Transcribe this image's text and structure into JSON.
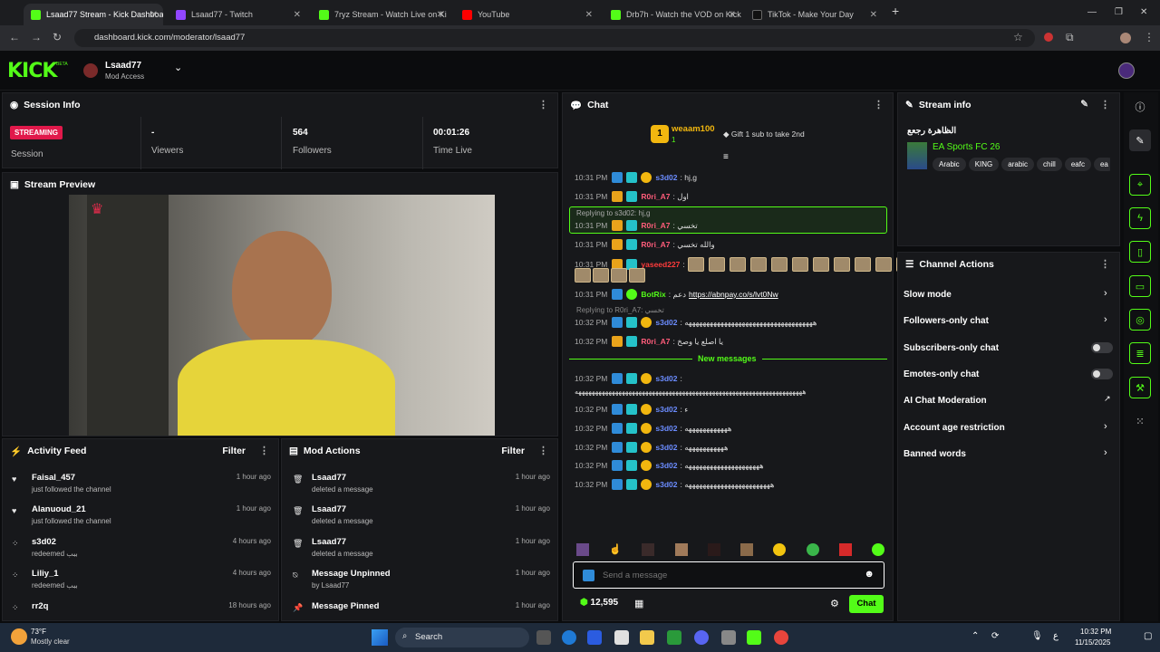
{
  "browser": {
    "tabs": [
      {
        "title": "Lsaad77 Stream - Kick Dashboa",
        "color": "#53fc18",
        "active": true
      },
      {
        "title": "Lsaad77 - Twitch",
        "color": "#9146ff"
      },
      {
        "title": "7ryz Stream - Watch Live on Ki",
        "color": "#53fc18"
      },
      {
        "title": "YouTube",
        "color": "#ff0000"
      },
      {
        "title": "Drb7h - Watch the VOD on Kick",
        "color": "#53fc18"
      },
      {
        "title": "TikTok - Make Your Day",
        "color": "#111111"
      }
    ],
    "url": "dashboard.kick.com/moderator/lsaad77"
  },
  "header": {
    "logo": "KICK",
    "beta": "BETA",
    "username": "Lsaad77",
    "role": "Mod Access"
  },
  "session": {
    "title": "Session Info",
    "status": "STREAMING",
    "status_label": "Session",
    "stats": [
      {
        "value": "-",
        "label": "Viewers"
      },
      {
        "value": "564",
        "label": "Followers"
      },
      {
        "value": "00:01:26",
        "label": "Time Live"
      }
    ],
    "preview_title": "Stream Preview"
  },
  "activity": {
    "title": "Activity Feed",
    "filter": "Filter",
    "items": [
      {
        "name": "Faisal_457",
        "sub": "just followed the channel",
        "time": "1 hour ago",
        "icon": "heart-icon"
      },
      {
        "name": "Alanuoud_21",
        "sub": "just followed the channel",
        "time": "1 hour ago",
        "icon": "heart-icon"
      },
      {
        "name": "s3d02",
        "sub": "redeemed ببب",
        "time": "4 hours ago",
        "icon": "points-icon"
      },
      {
        "name": "Liliy_1",
        "sub": "redeemed ببب",
        "time": "4 hours ago",
        "icon": "points-icon"
      },
      {
        "name": "rr2q",
        "sub": "",
        "time": "18 hours ago",
        "icon": "points-icon"
      }
    ]
  },
  "modactions": {
    "title": "Mod Actions",
    "filter": "Filter",
    "items": [
      {
        "name": "Lsaad77",
        "sub": "deleted a message",
        "time": "1 hour ago"
      },
      {
        "name": "Lsaad77",
        "sub": "deleted a message",
        "time": "1 hour ago"
      },
      {
        "name": "Lsaad77",
        "sub": "deleted a message",
        "time": "1 hour ago"
      },
      {
        "name": "Message Unpinned",
        "sub": "by Lsaad77",
        "time": "1 hour ago"
      },
      {
        "name": "Message Pinned",
        "sub": "",
        "time": "1 hour ago"
      }
    ]
  },
  "chat": {
    "title": "Chat",
    "top_gifter": {
      "name": "weaam100",
      "count": "1",
      "text": "Gift 1 sub to take 2nd"
    },
    "messages": [
      {
        "time": "10:31 PM",
        "user": "s3d02",
        "color": "#6b8cff",
        "text": ": hj,g"
      },
      {
        "time": "10:31 PM",
        "user": "R0ri_A7",
        "color": "#ff5c7a",
        "text": ": اول"
      },
      {
        "time": "10:31 PM",
        "user": "R0ri_A7",
        "color": "#ff5c7a",
        "text": ": تخسي",
        "reply": "Replying to s3d02: hj,g"
      },
      {
        "time": "10:31 PM",
        "user": "R0ri_A7",
        "color": "#ff5c7a",
        "text": ": والله تخسي"
      },
      {
        "time": "10:31 PM",
        "user": "yaseed227",
        "color": "#ff3b3b",
        "text": ":"
      },
      {
        "time": "10:31 PM",
        "user": "BotRix",
        "color": "#53fc18",
        "text": ": دعم",
        "link": "https://abnpay.co/s/lvt0Nw"
      },
      {
        "time": "10:32 PM",
        "user": "s3d02",
        "color": "#6b8cff",
        "text": ": ههههههههههههههههههههههههههههههههههههه",
        "reply": "Replying to R0ri_A7: تخسي"
      },
      {
        "time": "10:32 PM",
        "user": "R0ri_A7",
        "color": "#ff5c7a",
        "text": ": يا اصلع يا وصخ"
      }
    ],
    "new_label": "New messages",
    "new_messages": [
      {
        "time": "10:32 PM",
        "user": "s3d02",
        "text": ":"
      },
      {
        "time": "10:32 PM",
        "user": "s3d02",
        "text": ": ء"
      },
      {
        "time": "10:32 PM",
        "user": "s3d02",
        "text": ": ههههههههههههه"
      },
      {
        "time": "10:32 PM",
        "user": "s3d02",
        "text": ": هههههههههههه"
      },
      {
        "time": "10:32 PM",
        "user": "s3d02",
        "text": ": هههههههههههههههههههههه"
      },
      {
        "time": "10:32 PM",
        "user": "s3d02",
        "text": ": ههههههههههههههههههههههههه"
      }
    ],
    "long_line": "ههههههههههههههههههههههههههههههههههههههههههههههههههههههههههههههههههههه",
    "placeholder": "Send a message",
    "points": "12,595",
    "send": "Chat"
  },
  "streaminfo": {
    "title": "Stream info",
    "stream_title": "الظاهرة رجعع",
    "category": "EA Sports FC 26",
    "tags": [
      "Arabic",
      "KING",
      "arabic",
      "chill",
      "eafc",
      "ea"
    ]
  },
  "channel": {
    "title": "Channel Actions",
    "items": [
      {
        "label": "Slow mode",
        "ctl": "chevron"
      },
      {
        "label": "Followers-only chat",
        "ctl": "chevron"
      },
      {
        "label": "Subscribers-only chat",
        "ctl": "toggle"
      },
      {
        "label": "Emotes-only chat",
        "ctl": "toggle"
      },
      {
        "label": "AI Chat Moderation",
        "ctl": "external"
      },
      {
        "label": "Account age restriction",
        "ctl": "chevron"
      },
      {
        "label": "Banned words",
        "ctl": "chevron"
      }
    ]
  },
  "taskbar": {
    "temp": "73°F",
    "weather": "Mostly clear",
    "search": "Search",
    "time": "10:32 PM",
    "date": "11/15/2025"
  }
}
